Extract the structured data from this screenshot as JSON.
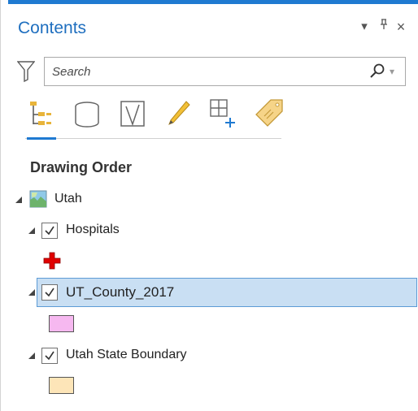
{
  "pane": {
    "title": "Contents",
    "controls": {
      "options_glyph": "▾",
      "pin_glyph": "⊥",
      "close_glyph": "×"
    }
  },
  "search": {
    "placeholder": "Search",
    "value": ""
  },
  "tabs": [
    {
      "icon": "list-by-drawing-order-icon",
      "active": true
    },
    {
      "icon": "list-by-data-source-icon",
      "active": false
    },
    {
      "icon": "list-by-selection-icon",
      "active": false
    },
    {
      "icon": "list-by-editing-icon",
      "active": false
    },
    {
      "icon": "list-by-snapping-icon",
      "active": false
    },
    {
      "icon": "list-by-labeling-icon",
      "active": false
    }
  ],
  "section_title": "Drawing Order",
  "map": {
    "name": "Utah",
    "icon": "map-icon"
  },
  "layers": [
    {
      "name": "Hospitals",
      "checked": true,
      "symbol": "red-cross-symbol",
      "symbol_color": "#e00000"
    },
    {
      "name": "UT_County_2017",
      "checked": true,
      "selected": true,
      "symbol": "polygon-symbol",
      "symbol_color": "#f6b8f0"
    },
    {
      "name": "Utah State Boundary",
      "checked": true,
      "symbol": "polygon-symbol",
      "symbol_color": "#fde5b8"
    }
  ],
  "colors": {
    "accent": "#1f7ad1",
    "title": "#1f6fbf",
    "selection_fill": "#c9dff3",
    "selection_border": "#5c9bd5"
  }
}
